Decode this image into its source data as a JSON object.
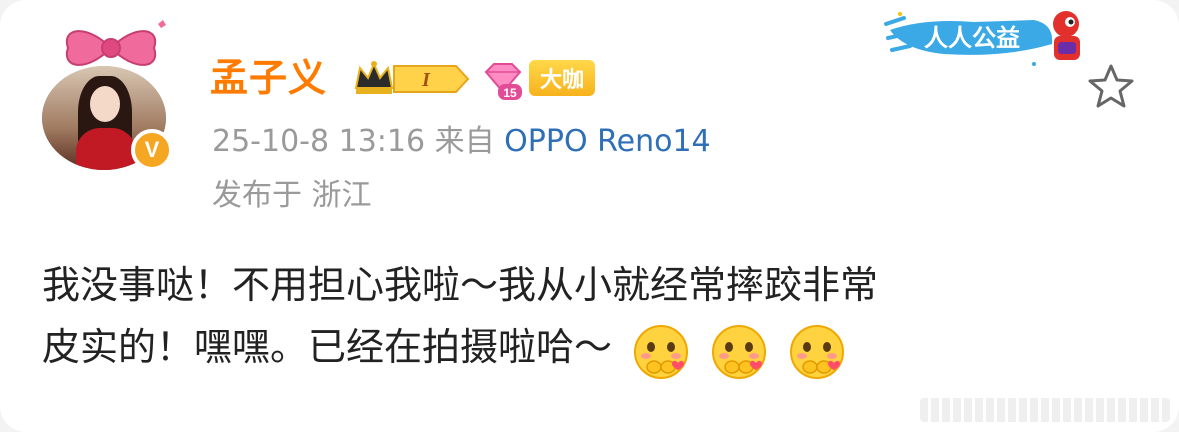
{
  "post": {
    "author": "孟子义",
    "level_badge": "I",
    "diamond_level": "15",
    "tag_badge": "大咖",
    "timestamp": "25-10-8 13:16",
    "source_prefix": "来自",
    "source_device": "OPPO Reno14",
    "location": "发布于 浙江",
    "public_welfare_badge": "人人公益",
    "text_line1": "我没事哒！不用担心我啦～我从小就经常摔跤非常",
    "text_line2": "皮实的！嘿嘿。已经在拍摄啦哈～",
    "emojis": [
      "hug-emoji",
      "hug-emoji",
      "hug-emoji"
    ]
  },
  "icons": {
    "verified": "V",
    "favorite": "star-icon"
  },
  "colors": {
    "author_name": "#ff7b00",
    "source_link": "#2f6fb8",
    "meta_text": "#9a9a9a",
    "verified_badge": "#f5a623",
    "tag_badge": "#f7b21c"
  }
}
